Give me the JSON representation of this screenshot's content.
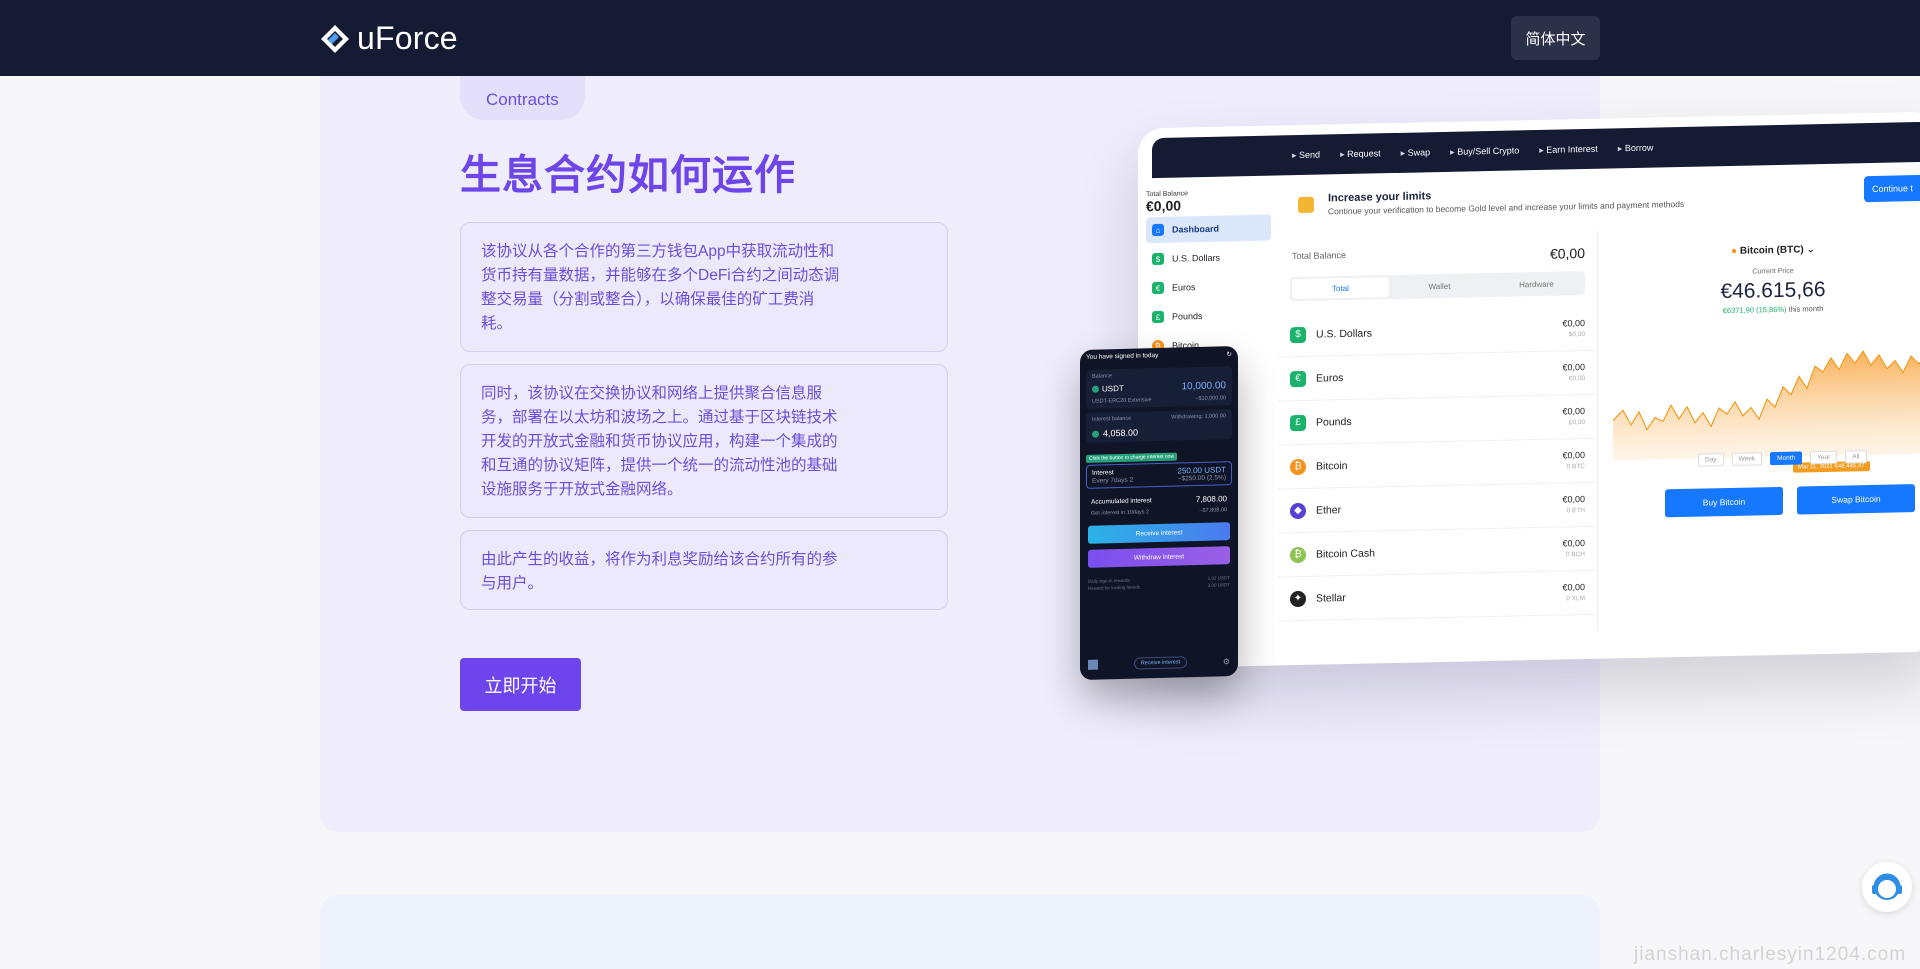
{
  "header": {
    "brand": "uForce",
    "language_label": "简体中文"
  },
  "section": {
    "tag": "Contracts",
    "title": "生息合约如何运作",
    "paragraphs": [
      "该协议从各个合作的第三方钱包App中获取流动性和货币持有量数据，并能够在多个DeFi合约之间动态调整交易量（分割或整合），以确保最佳的矿工费消耗。",
      "同时，该协议在交换协议和网络上提供聚合信息服务，部署在以太坊和波场之上。通过基于区块链技术开发的开放式金融和货币协议应用，构建一个集成的和互通的协议矩阵，提供一个统一的流动性池的基础设施服务于开放式金融网络。",
      "由此产生的收益，将作为利息奖励给该合约所有的参与用户。"
    ],
    "cta_label": "立即开始"
  },
  "tablet": {
    "nav": [
      "Send",
      "Request",
      "Swap",
      "Buy/Sell Crypto",
      "Earn Interest",
      "Borrow"
    ],
    "total_balance_label": "Total Balance",
    "total_balance": "€0,00",
    "sidebar": [
      {
        "label": "Dashboard",
        "icon": "home-icon",
        "color": "#1677ff"
      },
      {
        "label": "U.S. Dollars",
        "icon": "$",
        "color": "#19b36b"
      },
      {
        "label": "Euros",
        "icon": "€",
        "color": "#19b36b"
      },
      {
        "label": "Pounds",
        "icon": "£",
        "color": "#19b36b"
      },
      {
        "label": "Bitcoin",
        "icon": "₿",
        "color": "#f7931a"
      }
    ],
    "banner_title": "Increase your limits",
    "banner_sub": "Continue your verification to become Gold level and increase your limits and payment methods",
    "banner_button": "Continue t",
    "list_balance_label": "Total Balance",
    "list_balance": "€0,00",
    "tabs": [
      "Total",
      "Wallet",
      "Hardware"
    ],
    "assets": [
      {
        "name": "U.S. Dollars",
        "icon": "$",
        "color": "#19b36b",
        "value": "€0,00",
        "sub": "$0,00"
      },
      {
        "name": "Euros",
        "icon": "€",
        "color": "#19b36b",
        "value": "€0,00",
        "sub": "€0,00"
      },
      {
        "name": "Pounds",
        "icon": "£",
        "color": "#19b36b",
        "value": "€0,00",
        "sub": "£0,00"
      },
      {
        "name": "Bitcoin",
        "icon": "₿",
        "color": "#f7931a",
        "value": "€0,00",
        "sub": "0 BTC"
      },
      {
        "name": "Ether",
        "icon": "◆",
        "color": "#5a3fd6",
        "value": "€0,00",
        "sub": "0 ETH"
      },
      {
        "name": "Bitcoin Cash",
        "icon": "₿",
        "color": "#8dc351",
        "value": "€0,00",
        "sub": "0 BCH"
      },
      {
        "name": "Stellar",
        "icon": "✦",
        "color": "#222222",
        "value": "€0,00",
        "sub": "0 XLM"
      }
    ],
    "coin_label": "Bitcoin (BTC)",
    "current_price_label": "Current Price",
    "price": "€46.615,66",
    "change": "€6371,90 (15,86%)",
    "change_suffix": "this month",
    "flag": "Mar 11, 2021 €48.445,47",
    "ranges": [
      "Day",
      "Week",
      "Month",
      "Year",
      "All"
    ],
    "buy_label": "Buy Bitcoin",
    "swap_label": "Swap Bitcoin"
  },
  "phone": {
    "top": "You have signed in today",
    "balance_label": "Balance",
    "coin": "USDT",
    "balance": "10,000.00",
    "balance_sub": "USDT-ERC20 Extensive",
    "balance_sub_right": "~$10,000.00",
    "interest_label": "Interest balance",
    "withdrawing_label": "Withdrawing: 1,000.00",
    "interest_balance": "4,058.00",
    "tag": "Click the button to charge interest now",
    "interest": "Interest",
    "interest_val": "250.00 USDT",
    "every": "Every 7days 2",
    "every_sub": "~$250.00 (2.5%)",
    "acc_label": "Accumulated interest",
    "acc_val": "7,808.00",
    "acc_sub": "Get interest in 10days 2",
    "acc_sub_right": "~$7,808.00",
    "btn1": "Receive interest",
    "btn2": "Withdraw interest",
    "foot1": "Daily sign-in rewards",
    "foot1_r": "1.02 USDT",
    "foot2": "Reward for inviting friends",
    "foot2_r": "3.00 USDT",
    "bottom_button": "Receive interest"
  },
  "watermark": "jianshan.charlesyin1204.com"
}
